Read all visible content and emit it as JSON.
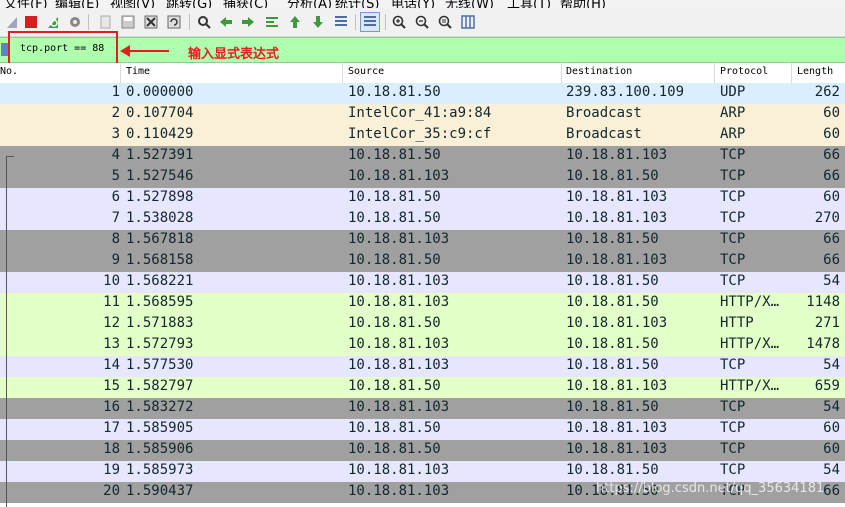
{
  "menu": [
    "文件(F)",
    "编辑(E)",
    "视图(V)",
    "跳转(G)",
    "捕获(C)",
    "分析(A)",
    "统计(S)",
    "电话(Y)",
    "无线(W)",
    "工具(T)",
    "帮助(H)"
  ],
  "toolbar": {
    "icons": [
      "shark-fin-start-icon",
      "stop-capture-icon",
      "restart-capture-icon",
      "capture-options-icon",
      "open-file-icon",
      "save-file-icon",
      "close-file-icon",
      "reload-icon",
      "find-packet-icon",
      "go-back-icon",
      "go-forward-icon",
      "go-to-packet-icon",
      "first-packet-icon",
      "last-packet-icon",
      "auto-scroll-icon",
      "colorize-icon",
      "zoom-in-icon",
      "zoom-out-icon",
      "normal-size-icon",
      "resize-columns-icon"
    ]
  },
  "filter": {
    "value": "tcp.port == 88",
    "bg_color": "#afffaf"
  },
  "annotation": {
    "text": "输入显式表达式",
    "color": "#e02020"
  },
  "columns": {
    "no": "No.",
    "time": "Time",
    "source": "Source",
    "destination": "Destination",
    "protocol": "Protocol",
    "length": "Length"
  },
  "packets": [
    {
      "no": "1",
      "time": "0.000000",
      "source": "10.18.81.50",
      "destination": "239.83.100.109",
      "protocol": "UDP",
      "length": "262",
      "bg": "#daeeff"
    },
    {
      "no": "2",
      "time": "0.107704",
      "source": "IntelCor_41:a9:84",
      "destination": "Broadcast",
      "protocol": "ARP",
      "length": "60",
      "bg": "#faf0d7"
    },
    {
      "no": "3",
      "time": "0.110429",
      "source": "IntelCor_35:c9:cf",
      "destination": "Broadcast",
      "protocol": "ARP",
      "length": "60",
      "bg": "#faf0d7"
    },
    {
      "no": "4",
      "time": "1.527391",
      "source": "10.18.81.50",
      "destination": "10.18.81.103",
      "protocol": "TCP",
      "length": "66",
      "bg": "#a0a0a0"
    },
    {
      "no": "5",
      "time": "1.527546",
      "source": "10.18.81.103",
      "destination": "10.18.81.50",
      "protocol": "TCP",
      "length": "66",
      "bg": "#a0a0a0"
    },
    {
      "no": "6",
      "time": "1.527898",
      "source": "10.18.81.50",
      "destination": "10.18.81.103",
      "protocol": "TCP",
      "length": "60",
      "bg": "#e7e6ff"
    },
    {
      "no": "7",
      "time": "1.538028",
      "source": "10.18.81.50",
      "destination": "10.18.81.103",
      "protocol": "TCP",
      "length": "270",
      "bg": "#e7e6ff"
    },
    {
      "no": "8",
      "time": "1.567818",
      "source": "10.18.81.103",
      "destination": "10.18.81.50",
      "protocol": "TCP",
      "length": "66",
      "bg": "#a0a0a0"
    },
    {
      "no": "9",
      "time": "1.568158",
      "source": "10.18.81.50",
      "destination": "10.18.81.103",
      "protocol": "TCP",
      "length": "66",
      "bg": "#a0a0a0"
    },
    {
      "no": "10",
      "time": "1.568221",
      "source": "10.18.81.103",
      "destination": "10.18.81.50",
      "protocol": "TCP",
      "length": "54",
      "bg": "#e7e6ff"
    },
    {
      "no": "11",
      "time": "1.568595",
      "source": "10.18.81.103",
      "destination": "10.18.81.50",
      "protocol": "HTTP/X…",
      "length": "1148",
      "bg": "#e4ffc7"
    },
    {
      "no": "12",
      "time": "1.571883",
      "source": "10.18.81.50",
      "destination": "10.18.81.103",
      "protocol": "HTTP",
      "length": "271",
      "bg": "#e4ffc7"
    },
    {
      "no": "13",
      "time": "1.572793",
      "source": "10.18.81.103",
      "destination": "10.18.81.50",
      "protocol": "HTTP/X…",
      "length": "1478",
      "bg": "#e4ffc7"
    },
    {
      "no": "14",
      "time": "1.577530",
      "source": "10.18.81.103",
      "destination": "10.18.81.50",
      "protocol": "TCP",
      "length": "54",
      "bg": "#e7e6ff"
    },
    {
      "no": "15",
      "time": "1.582797",
      "source": "10.18.81.50",
      "destination": "10.18.81.103",
      "protocol": "HTTP/X…",
      "length": "659",
      "bg": "#e4ffc7"
    },
    {
      "no": "16",
      "time": "1.583272",
      "source": "10.18.81.103",
      "destination": "10.18.81.50",
      "protocol": "TCP",
      "length": "54",
      "bg": "#a0a0a0"
    },
    {
      "no": "17",
      "time": "1.585905",
      "source": "10.18.81.50",
      "destination": "10.18.81.103",
      "protocol": "TCP",
      "length": "60",
      "bg": "#e7e6ff"
    },
    {
      "no": "18",
      "time": "1.585906",
      "source": "10.18.81.50",
      "destination": "10.18.81.103",
      "protocol": "TCP",
      "length": "60",
      "bg": "#a0a0a0"
    },
    {
      "no": "19",
      "time": "1.585973",
      "source": "10.18.81.103",
      "destination": "10.18.81.50",
      "protocol": "TCP",
      "length": "54",
      "bg": "#e7e6ff"
    },
    {
      "no": "20",
      "time": "1.590437",
      "source": "10.18.81.103",
      "destination": "10.18.81.50",
      "protocol": "TCP",
      "length": "66",
      "bg": "#a0a0a0"
    }
  ],
  "watermark": "https://blog.csdn.net/qq_35634181"
}
